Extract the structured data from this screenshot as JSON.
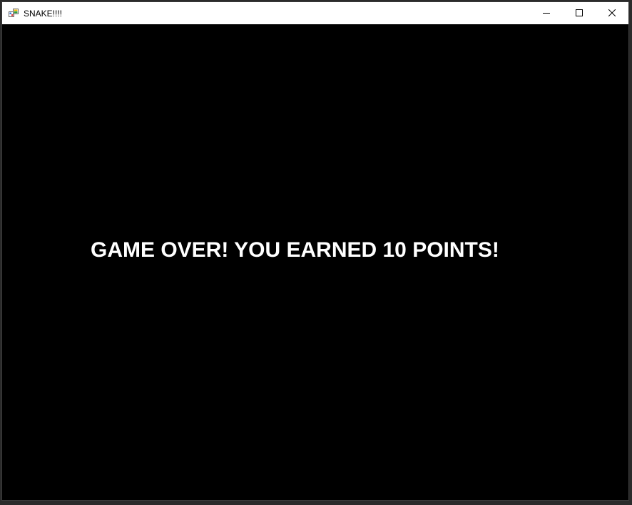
{
  "window": {
    "title": "SNAKE!!!!",
    "icon": "winforms-app-icon",
    "caption_buttons": [
      "minimize",
      "maximize",
      "close"
    ]
  },
  "game": {
    "message": "GAME OVER! YOU EARNED 10 POINTS!",
    "background_color": "#000000",
    "text_color": "#ffffff"
  }
}
